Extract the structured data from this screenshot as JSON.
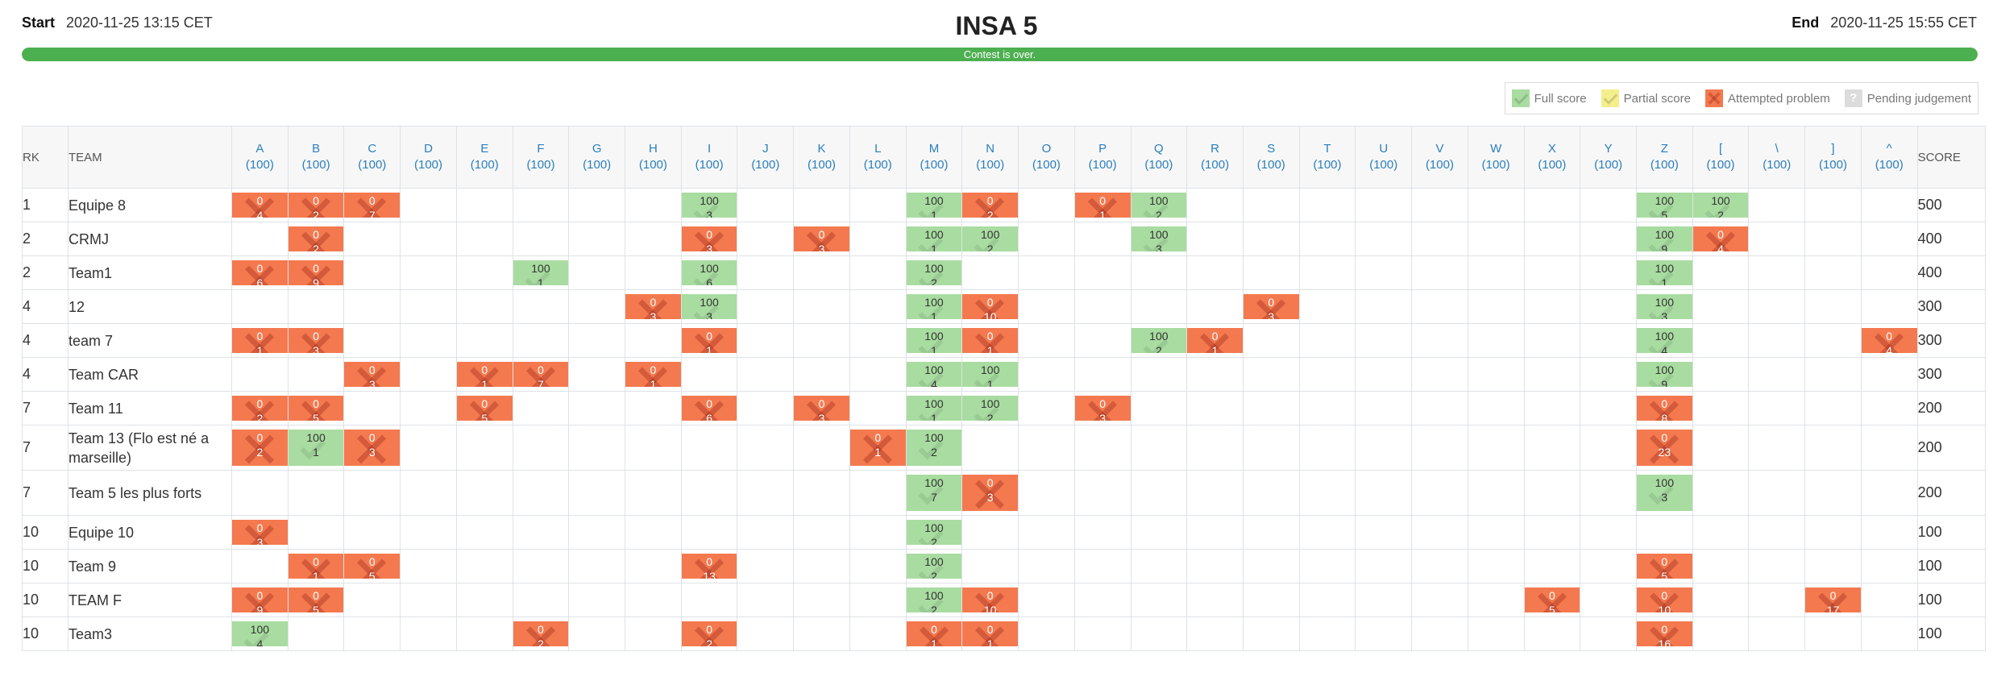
{
  "header": {
    "start_label": "Start",
    "start_time": "2020-11-25 13:15 CET",
    "title": "INSA 5",
    "end_label": "End",
    "end_time": "2020-11-25 15:55 CET"
  },
  "progress": {
    "label": "Contest is over.",
    "percent": 100,
    "color": "#4caf50"
  },
  "legend": {
    "full": "Full score",
    "partial": "Partial score",
    "attempted": "Attempted problem",
    "pending": "Pending judgement"
  },
  "colors": {
    "full": "#a8dca0",
    "partial": "#f4ef8a",
    "attempted": "#f4794f",
    "pending": "#dcdcdc",
    "link": "#2a7fbd"
  },
  "columns": {
    "rank": "RK",
    "team": "TEAM",
    "score": "SCORE"
  },
  "problems": [
    {
      "name": "A",
      "points": "(100)"
    },
    {
      "name": "B",
      "points": "(100)"
    },
    {
      "name": "C",
      "points": "(100)"
    },
    {
      "name": "D",
      "points": "(100)"
    },
    {
      "name": "E",
      "points": "(100)"
    },
    {
      "name": "F",
      "points": "(100)"
    },
    {
      "name": "G",
      "points": "(100)"
    },
    {
      "name": "H",
      "points": "(100)"
    },
    {
      "name": "I",
      "points": "(100)"
    },
    {
      "name": "J",
      "points": "(100)"
    },
    {
      "name": "K",
      "points": "(100)"
    },
    {
      "name": "L",
      "points": "(100)"
    },
    {
      "name": "M",
      "points": "(100)"
    },
    {
      "name": "N",
      "points": "(100)"
    },
    {
      "name": "O",
      "points": "(100)"
    },
    {
      "name": "P",
      "points": "(100)"
    },
    {
      "name": "Q",
      "points": "(100)"
    },
    {
      "name": "R",
      "points": "(100)"
    },
    {
      "name": "S",
      "points": "(100)"
    },
    {
      "name": "T",
      "points": "(100)"
    },
    {
      "name": "U",
      "points": "(100)"
    },
    {
      "name": "V",
      "points": "(100)"
    },
    {
      "name": "W",
      "points": "(100)"
    },
    {
      "name": "X",
      "points": "(100)"
    },
    {
      "name": "Y",
      "points": "(100)"
    },
    {
      "name": "Z",
      "points": "(100)"
    },
    {
      "name": "[",
      "points": "(100)"
    },
    {
      "name": "\\",
      "points": "(100)"
    },
    {
      "name": "]",
      "points": "(100)"
    },
    {
      "name": "^",
      "points": "(100)"
    }
  ],
  "rows": [
    {
      "rank": "1",
      "team": "Equipe 8",
      "score": "500",
      "cells": {
        "A": [
          "att",
          "0",
          "4"
        ],
        "B": [
          "att",
          "0",
          "2"
        ],
        "C": [
          "att",
          "0",
          "7"
        ],
        "I": [
          "full",
          "100",
          "3"
        ],
        "M": [
          "full",
          "100",
          "1"
        ],
        "N": [
          "att",
          "0",
          "2"
        ],
        "P": [
          "att",
          "0",
          "1"
        ],
        "Q": [
          "full",
          "100",
          "2"
        ],
        "Z": [
          "full",
          "100",
          "5"
        ],
        "[": [
          "full",
          "100",
          "2"
        ]
      }
    },
    {
      "rank": "2",
      "team": "CRMJ",
      "score": "400",
      "cells": {
        "B": [
          "att",
          "0",
          "2"
        ],
        "I": [
          "att",
          "0",
          "3"
        ],
        "K": [
          "att",
          "0",
          "3"
        ],
        "M": [
          "full",
          "100",
          "1"
        ],
        "N": [
          "full",
          "100",
          "2"
        ],
        "Q": [
          "full",
          "100",
          "3"
        ],
        "Z": [
          "full",
          "100",
          "9"
        ],
        "[": [
          "att",
          "0",
          "4"
        ]
      }
    },
    {
      "rank": "2",
      "team": "Team1",
      "score": "400",
      "cells": {
        "A": [
          "att",
          "0",
          "6"
        ],
        "B": [
          "att",
          "0",
          "9"
        ],
        "F": [
          "full",
          "100",
          "1"
        ],
        "I": [
          "full",
          "100",
          "6"
        ],
        "M": [
          "full",
          "100",
          "2"
        ],
        "Z": [
          "full",
          "100",
          "1"
        ]
      }
    },
    {
      "rank": "4",
      "team": "12",
      "score": "300",
      "cells": {
        "H": [
          "att",
          "0",
          "3"
        ],
        "I": [
          "full",
          "100",
          "3"
        ],
        "M": [
          "full",
          "100",
          "1"
        ],
        "N": [
          "att",
          "0",
          "10"
        ],
        "S": [
          "att",
          "0",
          "3"
        ],
        "Z": [
          "full",
          "100",
          "3"
        ]
      }
    },
    {
      "rank": "4",
      "team": "team 7",
      "score": "300",
      "cells": {
        "A": [
          "att",
          "0",
          "1"
        ],
        "B": [
          "att",
          "0",
          "3"
        ],
        "I": [
          "att",
          "0",
          "1"
        ],
        "M": [
          "full",
          "100",
          "1"
        ],
        "N": [
          "att",
          "0",
          "1"
        ],
        "Q": [
          "full",
          "100",
          "2"
        ],
        "R": [
          "att",
          "0",
          "1"
        ],
        "Z": [
          "full",
          "100",
          "4"
        ],
        "^": [
          "att",
          "0",
          "4"
        ]
      }
    },
    {
      "rank": "4",
      "team": "Team CAR",
      "score": "300",
      "cells": {
        "C": [
          "att",
          "0",
          "3"
        ],
        "E": [
          "att",
          "0",
          "1"
        ],
        "F": [
          "att",
          "0",
          "7"
        ],
        "H": [
          "att",
          "0",
          "1"
        ],
        "M": [
          "full",
          "100",
          "4"
        ],
        "N": [
          "full",
          "100",
          "1"
        ],
        "Z": [
          "full",
          "100",
          "9"
        ]
      }
    },
    {
      "rank": "7",
      "team": "Team 11",
      "score": "200",
      "cells": {
        "A": [
          "att",
          "0",
          "2"
        ],
        "B": [
          "att",
          "0",
          "5"
        ],
        "E": [
          "att",
          "0",
          "5"
        ],
        "I": [
          "att",
          "0",
          "6"
        ],
        "K": [
          "att",
          "0",
          "3"
        ],
        "M": [
          "full",
          "100",
          "1"
        ],
        "N": [
          "full",
          "100",
          "2"
        ],
        "P": [
          "att",
          "0",
          "3"
        ],
        "Z": [
          "att",
          "0",
          "8"
        ]
      }
    },
    {
      "rank": "7",
      "team": "Team 13 (Flo est né a marseille)",
      "score": "200",
      "cells": {
        "A": [
          "att",
          "0",
          "2"
        ],
        "B": [
          "full",
          "100",
          "1"
        ],
        "C": [
          "att",
          "0",
          "3"
        ],
        "L": [
          "att",
          "0",
          "1"
        ],
        "M": [
          "full",
          "100",
          "2"
        ],
        "Z": [
          "att",
          "0",
          "23"
        ]
      }
    },
    {
      "rank": "7",
      "team": "Team 5 les plus forts",
      "score": "200",
      "cells": {
        "M": [
          "full",
          "100",
          "7"
        ],
        "N": [
          "att",
          "0",
          "3"
        ],
        "Z": [
          "full",
          "100",
          "3"
        ]
      }
    },
    {
      "rank": "10",
      "team": "Equipe 10",
      "score": "100",
      "cells": {
        "A": [
          "att",
          "0",
          "3"
        ],
        "M": [
          "full",
          "100",
          "2"
        ]
      }
    },
    {
      "rank": "10",
      "team": "Team 9",
      "score": "100",
      "cells": {
        "B": [
          "att",
          "0",
          "1"
        ],
        "C": [
          "att",
          "0",
          "5"
        ],
        "I": [
          "att",
          "0",
          "13"
        ],
        "M": [
          "full",
          "100",
          "2"
        ],
        "Z": [
          "att",
          "0",
          "5"
        ]
      }
    },
    {
      "rank": "10",
      "team": "TEAM F",
      "score": "100",
      "cells": {
        "A": [
          "att",
          "0",
          "9"
        ],
        "B": [
          "att",
          "0",
          "5"
        ],
        "M": [
          "full",
          "100",
          "2"
        ],
        "N": [
          "att",
          "0",
          "10"
        ],
        "X": [
          "att",
          "0",
          "5"
        ],
        "Z": [
          "att",
          "0",
          "10"
        ],
        "]": [
          "att",
          "0",
          "17"
        ]
      }
    },
    {
      "rank": "10",
      "team": "Team3",
      "score": "100",
      "cells": {
        "A": [
          "full",
          "100",
          "4"
        ],
        "F": [
          "att",
          "0",
          "2"
        ],
        "I": [
          "att",
          "0",
          "2"
        ],
        "M": [
          "att",
          "0",
          "1"
        ],
        "N": [
          "att",
          "0",
          "1"
        ],
        "Z": [
          "att",
          "0",
          "16"
        ]
      }
    }
  ]
}
